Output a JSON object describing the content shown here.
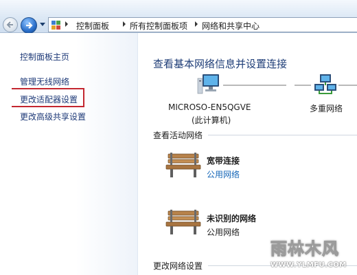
{
  "address_bar": {
    "breadcrumbs": [
      "控制面板",
      "所有控制面板项",
      "网络和共享中心"
    ]
  },
  "left_pane": {
    "links": [
      "控制面板主页",
      "管理无线网络",
      "更改适配器设置",
      "更改高级共享设置"
    ],
    "highlighted_link": "更改适配器设置",
    "highlight_color": "#c3262f"
  },
  "main": {
    "title": "查看基本网络信息并设置连接",
    "network_map": {
      "computer_name": "MICROSO-EN5QGVE",
      "computer_sub": "(此计算机)",
      "network": "多重网络"
    },
    "active_networks_label": "查看活动网络",
    "networks": [
      {
        "name": "宽带连接",
        "type": "公用网络",
        "type_is_link": true
      },
      {
        "name": "未识别的网络",
        "type": "公用网络",
        "type_is_link": false
      }
    ],
    "change_settings_label": "更改网络设置"
  },
  "watermark": {
    "logo": "雨林木风",
    "url": "WWW.YLMFU.COM"
  },
  "colors": {
    "title": "#1e3d77",
    "link": "#1667b8",
    "left_link": "#1e3a78"
  }
}
